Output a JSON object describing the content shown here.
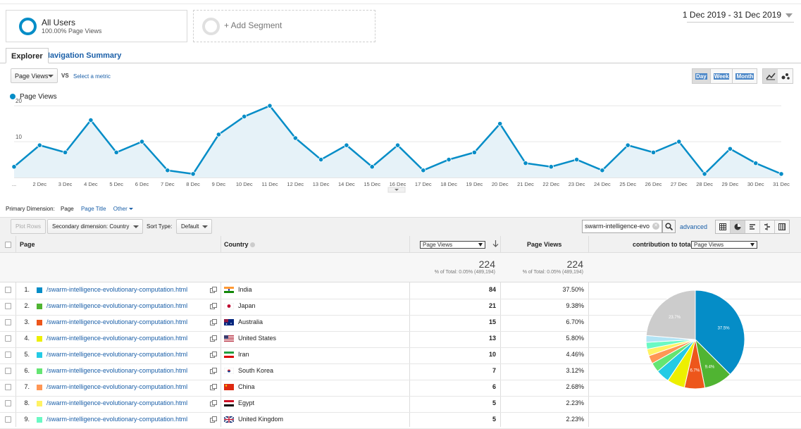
{
  "segments": {
    "all_users": {
      "title": "All Users",
      "subtitle": "100.00% Page Views"
    },
    "add_segment": "+ Add Segment"
  },
  "date_range": "1 Dec 2019 - 31 Dec 2019",
  "tabs": [
    "Explorer",
    "Navigation Summary"
  ],
  "metric": {
    "selected": "Page Views",
    "vs": "VS",
    "select_metric": "Select a metric"
  },
  "period_buttons": [
    "Day",
    "Week",
    "Month"
  ],
  "chart_data": {
    "type": "area",
    "series": [
      {
        "name": "Page Views",
        "color": "#058dc7",
        "values": [
          3,
          9,
          7,
          16,
          7,
          10,
          2,
          1,
          12,
          17,
          20,
          11,
          5,
          9,
          3,
          9,
          2,
          5,
          7,
          15,
          4,
          3,
          5,
          2,
          9,
          7,
          10,
          1,
          8,
          4,
          1
        ]
      }
    ],
    "x": [
      "1 Dec",
      "2 Dec",
      "3 Dec",
      "4 Dec",
      "5 Dec",
      "6 Dec",
      "7 Dec",
      "8 Dec",
      "9 Dec",
      "10 Dec",
      "11 Dec",
      "12 Dec",
      "13 Dec",
      "14 Dec",
      "15 Dec",
      "16 Dec",
      "17 Dec",
      "18 Dec",
      "19 Dec",
      "20 Dec",
      "21 Dec",
      "22 Dec",
      "23 Dec",
      "24 Dec",
      "25 Dec",
      "26 Dec",
      "27 Dec",
      "28 Dec",
      "29 Dec",
      "30 Dec",
      "31 Dec"
    ],
    "x_tick_labels": [
      "...",
      "2 Dec",
      "3 Dec",
      "4 Dec",
      "5 Dec",
      "6 Dec",
      "7 Dec",
      "8 Dec",
      "9 Dec",
      "10 Dec",
      "11 Dec",
      "12 Dec",
      "13 Dec",
      "14 Dec",
      "15 Dec",
      "16 Dec",
      "17 Dec",
      "18 Dec",
      "19 Dec",
      "20 Dec",
      "21 Dec",
      "22 Dec",
      "23 Dec",
      "24 Dec",
      "25 Dec",
      "26 Dec",
      "27 Dec",
      "28 Dec",
      "29 Dec",
      "30 Dec",
      "31 Dec"
    ],
    "y_ticks": [
      "10",
      "20"
    ],
    "ylim": [
      0,
      22
    ],
    "grid": true,
    "legend": "top-left"
  },
  "primary_dimension": {
    "label": "Primary Dimension:",
    "current": "Page",
    "options": [
      "Page Title",
      "Other"
    ]
  },
  "toolbar": {
    "plot_rows": "Plot Rows",
    "secondary_dimension": "Secondary dimension: Country",
    "sort_type_label": "Sort Type:",
    "sort_type": "Default",
    "search_value": "swarm-intelligence-evo",
    "advanced": "advanced"
  },
  "table": {
    "headers": {
      "page": "Page",
      "country": "Country",
      "metric_select": "Page Views",
      "page_views": "Page Views",
      "contribution": "contribution to total:",
      "contribution_select": "Page Views"
    },
    "totals": {
      "value1": "224",
      "sub1": "% of Total: 0.05% (489,194)",
      "value2": "224",
      "sub2": "% of Total: 0.05% (489,194)"
    },
    "rows": [
      {
        "rank": "1.",
        "page": "/swarm-intelligence-evolutionary-computation.html",
        "country": "India",
        "views": "84",
        "pct": "37.50%",
        "color": "#058dc7"
      },
      {
        "rank": "2.",
        "page": "/swarm-intelligence-evolutionary-computation.html",
        "country": "Japan",
        "views": "21",
        "pct": "9.38%",
        "color": "#50b432"
      },
      {
        "rank": "3.",
        "page": "/swarm-intelligence-evolutionary-computation.html",
        "country": "Australia",
        "views": "15",
        "pct": "6.70%",
        "color": "#ed561b"
      },
      {
        "rank": "4.",
        "page": "/swarm-intelligence-evolutionary-computation.html",
        "country": "United States",
        "views": "13",
        "pct": "5.80%",
        "color": "#edef00"
      },
      {
        "rank": "5.",
        "page": "/swarm-intelligence-evolutionary-computation.html",
        "country": "Iran",
        "views": "10",
        "pct": "4.46%",
        "color": "#24cbe5"
      },
      {
        "rank": "6.",
        "page": "/swarm-intelligence-evolutionary-computation.html",
        "country": "South Korea",
        "views": "7",
        "pct": "3.12%",
        "color": "#64e572"
      },
      {
        "rank": "7.",
        "page": "/swarm-intelligence-evolutionary-computation.html",
        "country": "China",
        "views": "6",
        "pct": "2.68%",
        "color": "#ff9655"
      },
      {
        "rank": "8.",
        "page": "/swarm-intelligence-evolutionary-computation.html",
        "country": "Egypt",
        "views": "5",
        "pct": "2.23%",
        "color": "#fff263"
      },
      {
        "rank": "9.",
        "page": "/swarm-intelligence-evolutionary-computation.html",
        "country": "United Kingdom",
        "views": "5",
        "pct": "2.23%",
        "color": "#6af9c4"
      }
    ]
  },
  "pie": {
    "slices": [
      {
        "value": 37.5,
        "color": "#058dc7",
        "label": "37.5%"
      },
      {
        "value": 9.38,
        "color": "#50b432",
        "label": "9.4%"
      },
      {
        "value": 6.7,
        "color": "#ed561b",
        "label": "6.7%"
      },
      {
        "value": 5.8,
        "color": "#edef00",
        "label": ""
      },
      {
        "value": 4.46,
        "color": "#24cbe5",
        "label": ""
      },
      {
        "value": 3.12,
        "color": "#64e572",
        "label": ""
      },
      {
        "value": 2.68,
        "color": "#ff9655",
        "label": ""
      },
      {
        "value": 2.23,
        "color": "#fff263",
        "label": ""
      },
      {
        "value": 2.23,
        "color": "#6af9c4",
        "label": ""
      },
      {
        "value": 2.2,
        "color": "#b2e4f5",
        "label": ""
      },
      {
        "value": 23.7,
        "color": "#cccccc",
        "label": "23.7%"
      }
    ]
  }
}
